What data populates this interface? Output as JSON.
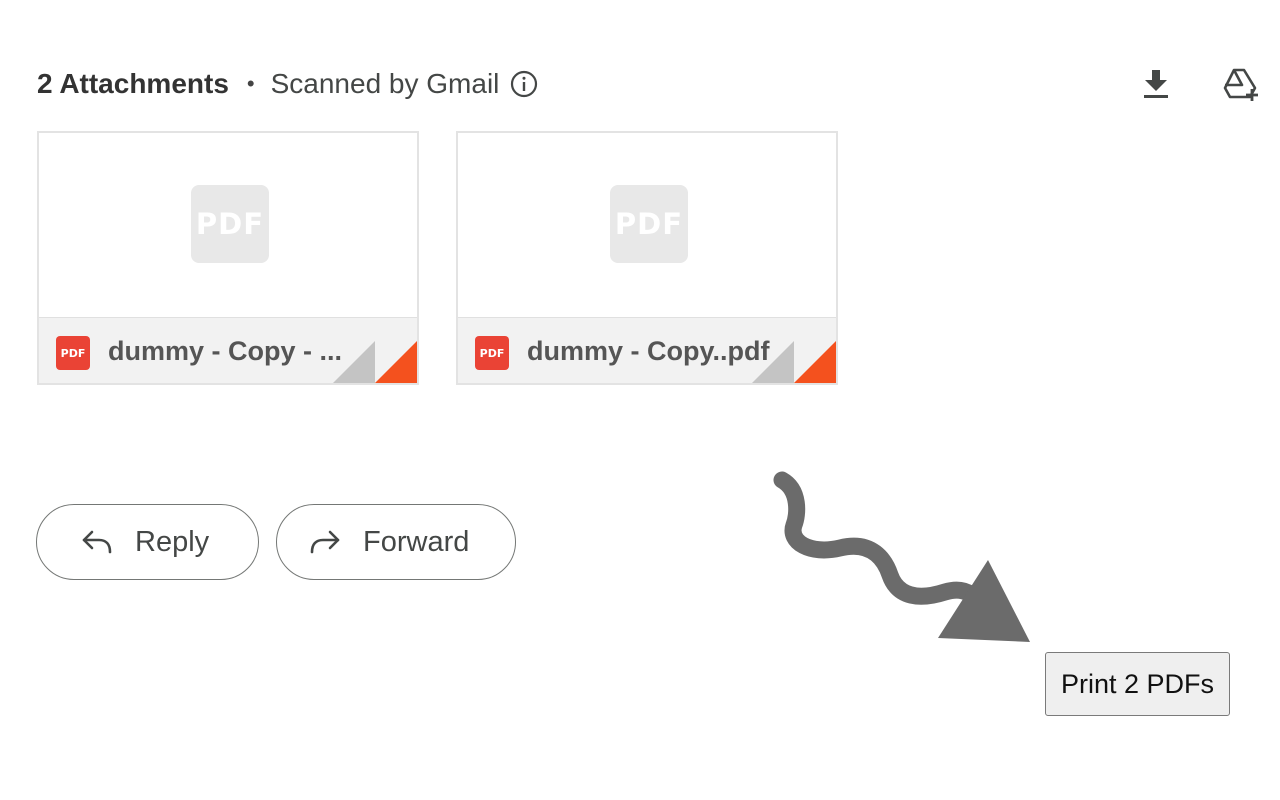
{
  "attachments": {
    "count_label": "2 Attachments",
    "separator": "•",
    "scanned_label": "Scanned by Gmail",
    "actions": {
      "download_icon": "download-icon",
      "drive_icon": "add-to-drive-icon"
    },
    "files": [
      {
        "thumb_label": "PDF",
        "badge": "PDF",
        "name": "dummy - Copy - ..."
      },
      {
        "thumb_label": "PDF",
        "badge": "PDF",
        "name": "dummy - Copy..pdf"
      }
    ]
  },
  "actions": {
    "reply_label": "Reply",
    "forward_label": "Forward"
  },
  "extension": {
    "print_label": "Print 2 PDFs"
  },
  "colors": {
    "pdf_red": "#ea4335",
    "fold_orange": "#f4511e",
    "arrow_gray": "#6b6b6b"
  }
}
